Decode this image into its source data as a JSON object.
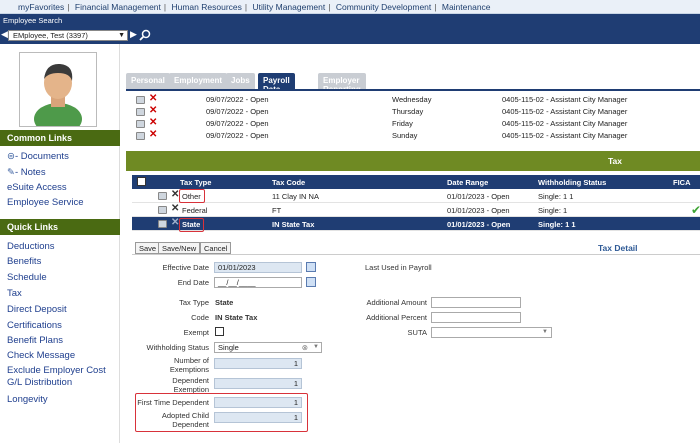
{
  "topnav": [
    "myFavorites",
    "Financial Management",
    "Human Resources",
    "Utility Management",
    "Community Development",
    "Maintenance"
  ],
  "search": {
    "label": "Employee Search",
    "employee": "EMployee, Test (3397)"
  },
  "sidebar": {
    "common_head": "Common Links",
    "common": [
      "- Documents",
      "- Notes",
      "eSuite Access",
      "Employee Service"
    ],
    "quick_head": "Quick Links",
    "quick": [
      "Deductions",
      "Benefits",
      "Schedule",
      "Tax",
      "Direct Deposit",
      "Certifications",
      "Benefit Plans",
      "Check Message",
      "Exclude Employer Cost G/L Distribution",
      "Longevity"
    ]
  },
  "tabs": [
    "Personal",
    "Employment",
    "Jobs",
    "Payroll Data",
    "Employer Reporting"
  ],
  "schedule": [
    {
      "date": "09/07/2022 - Open",
      "day": "Wednesday",
      "job": "0405-115-02 - Assistant City Manager"
    },
    {
      "date": "09/07/2022 - Open",
      "day": "Thursday",
      "job": "0405-115-02 - Assistant City Manager"
    },
    {
      "date": "09/07/2022 - Open",
      "day": "Friday",
      "job": "0405-115-02 - Assistant City Manager"
    },
    {
      "date": "09/07/2022 - Open",
      "day": "Sunday",
      "job": "0405-115-02 - Assistant City Manager"
    }
  ],
  "tax": {
    "title": "Tax",
    "headers": [
      "Tax Type",
      "Tax Code",
      "Date Range",
      "Withholding Status",
      "FICA"
    ],
    "rows": [
      {
        "type": "Other",
        "code": "11 Clay IN NA",
        "range": "01/01/2023 - Open",
        "status": "Single: 1 1",
        "fica": ""
      },
      {
        "type": "Federal",
        "code": "FT",
        "range": "01/01/2023 - Open",
        "status": "Single: 1",
        "fica": "✔"
      },
      {
        "type": "State",
        "code": "IN State Tax",
        "range": "01/01/2023 - Open",
        "status": "Single: 1 1",
        "fica": ""
      }
    ]
  },
  "buttons": {
    "save": "Save",
    "save_new": "Save/New",
    "cancel": "Cancel"
  },
  "detail": {
    "title": "Tax Detail",
    "effective_label": "Effective Date",
    "effective": "01/01/2023",
    "end_label": "End Date",
    "end": "__/__/____",
    "last_used": "Last Used in Payroll",
    "tax_type_label": "Tax Type",
    "tax_type": "State",
    "code_label": "Code",
    "code": "IN State Tax",
    "exempt_label": "Exempt",
    "withholding_label": "Withholding Status",
    "withholding": "Single",
    "exemptions_label": "Number of Exemptions",
    "exemptions": "1",
    "dep_exemption_label": "Dependent Exemption",
    "dep_exemption": "1",
    "first_time_label": "First Time Dependent",
    "first_time": "1",
    "adopted_label": "Adopted Child Dependent",
    "adopted": "1",
    "add_amount_label": "Additional Amount",
    "add_percent_label": "Additional Percent",
    "suta_label": "SUTA"
  }
}
